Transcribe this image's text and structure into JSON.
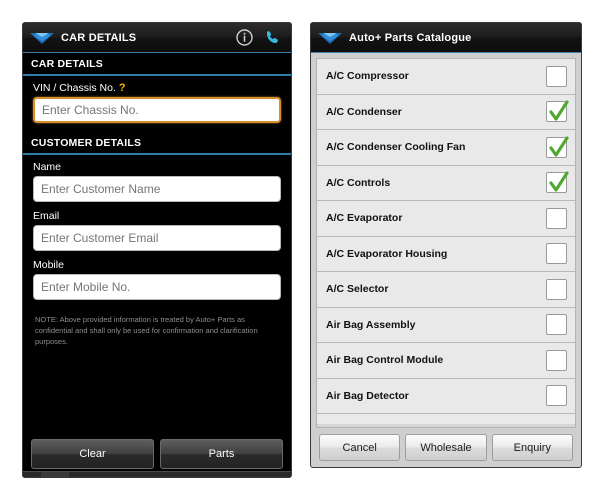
{
  "left_phone": {
    "titlebar": {
      "title": "CAR DETAILS",
      "logo_icon": "diamond-car-logo-icon",
      "info_icon": "info-icon",
      "call_icon": "phone-call-icon"
    },
    "sections": [
      {
        "header": "CAR DETAILS"
      },
      {
        "header": "CUSTOMER DETAILS"
      }
    ],
    "car_details": {
      "vin_label": "VIN / Chassis No.",
      "vin_help": "?",
      "vin_placeholder": "Enter Chassis No.",
      "vin_value": ""
    },
    "customer_details": {
      "name_label": "Name",
      "name_placeholder": "Enter Customer Name",
      "name_value": "",
      "email_label": "Email",
      "email_placeholder": "Enter Customer Email",
      "email_value": "",
      "mobile_label": "Mobile",
      "mobile_placeholder": "Enter Mobile No.",
      "mobile_value": ""
    },
    "note": "NOTE: Above provided information is treated by Auto+ Parts as confidential and shall only be used for confirmation and clarification purposes.",
    "buttons": {
      "clear": "Clear",
      "parts": "Parts"
    }
  },
  "right_phone": {
    "titlebar": {
      "title": "Auto+ Parts Catalogue",
      "logo_icon": "diamond-car-logo-icon"
    },
    "items": [
      {
        "label": "A/C Compressor",
        "checked": false
      },
      {
        "label": "A/C Condenser",
        "checked": true
      },
      {
        "label": "A/C Condenser Cooling Fan",
        "checked": true
      },
      {
        "label": "A/C Controls",
        "checked": true
      },
      {
        "label": "A/C Evaporator",
        "checked": false
      },
      {
        "label": "A/C Evaporator Housing",
        "checked": false
      },
      {
        "label": "A/C Selector",
        "checked": false
      },
      {
        "label": "Air Bag Assembly",
        "checked": false
      },
      {
        "label": "Air Bag Control Module",
        "checked": false
      },
      {
        "label": "Air Bag Detector",
        "checked": false
      }
    ],
    "buttons": {
      "cancel": "Cancel",
      "wholesale": "Wholesale",
      "enquiry": "Enquiry"
    },
    "colors": {
      "accent": "#3f7fa8",
      "check": "#4fa832",
      "focus_border": "#d78f2a"
    }
  }
}
